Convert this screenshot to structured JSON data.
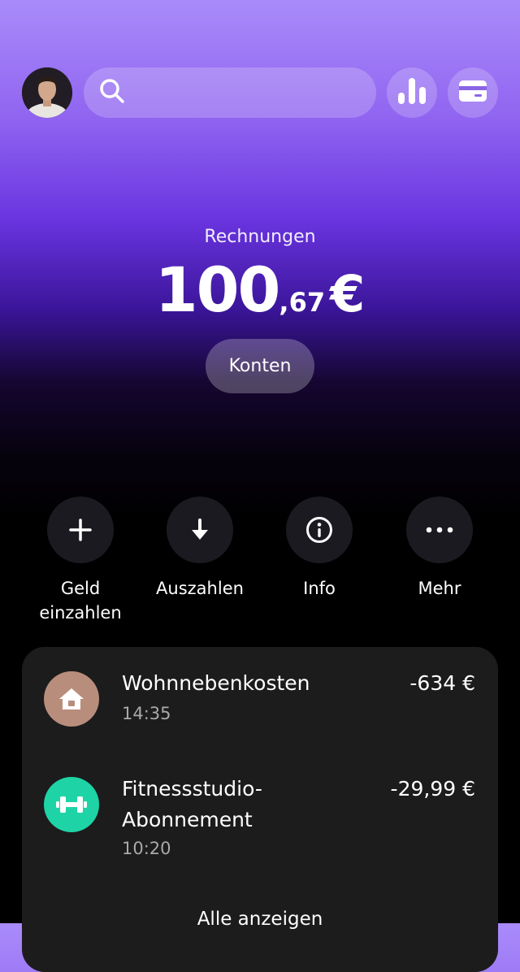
{
  "header": {
    "search": {
      "placeholder": "",
      "value": ""
    },
    "icons": {
      "search": "search-icon",
      "stats": "bar-chart-icon",
      "card": "credit-card-icon"
    }
  },
  "balance": {
    "label": "Rechnungen",
    "integer": "100",
    "decimal": ",67",
    "currency": "€"
  },
  "konten_button": "Konten",
  "actions": [
    {
      "label": "Geld\neinzahlen",
      "icon": "plus-icon"
    },
    {
      "label": "Auszahlen",
      "icon": "arrow-down-icon"
    },
    {
      "label": "Info",
      "icon": "info-icon"
    },
    {
      "label": "Mehr",
      "icon": "more-dots-icon"
    }
  ],
  "transactions": [
    {
      "title": "Wohnnebenkosten",
      "time": "14:35",
      "amount": "-634 €",
      "icon": "house-icon",
      "color": "#b98d7c"
    },
    {
      "title": "Fitnessstudio-\nAbonnement",
      "time": "10:20",
      "amount": "-29,99 €",
      "icon": "dumbbell-icon",
      "color": "#1ed4a6"
    }
  ],
  "show_all": "Alle anzeigen"
}
